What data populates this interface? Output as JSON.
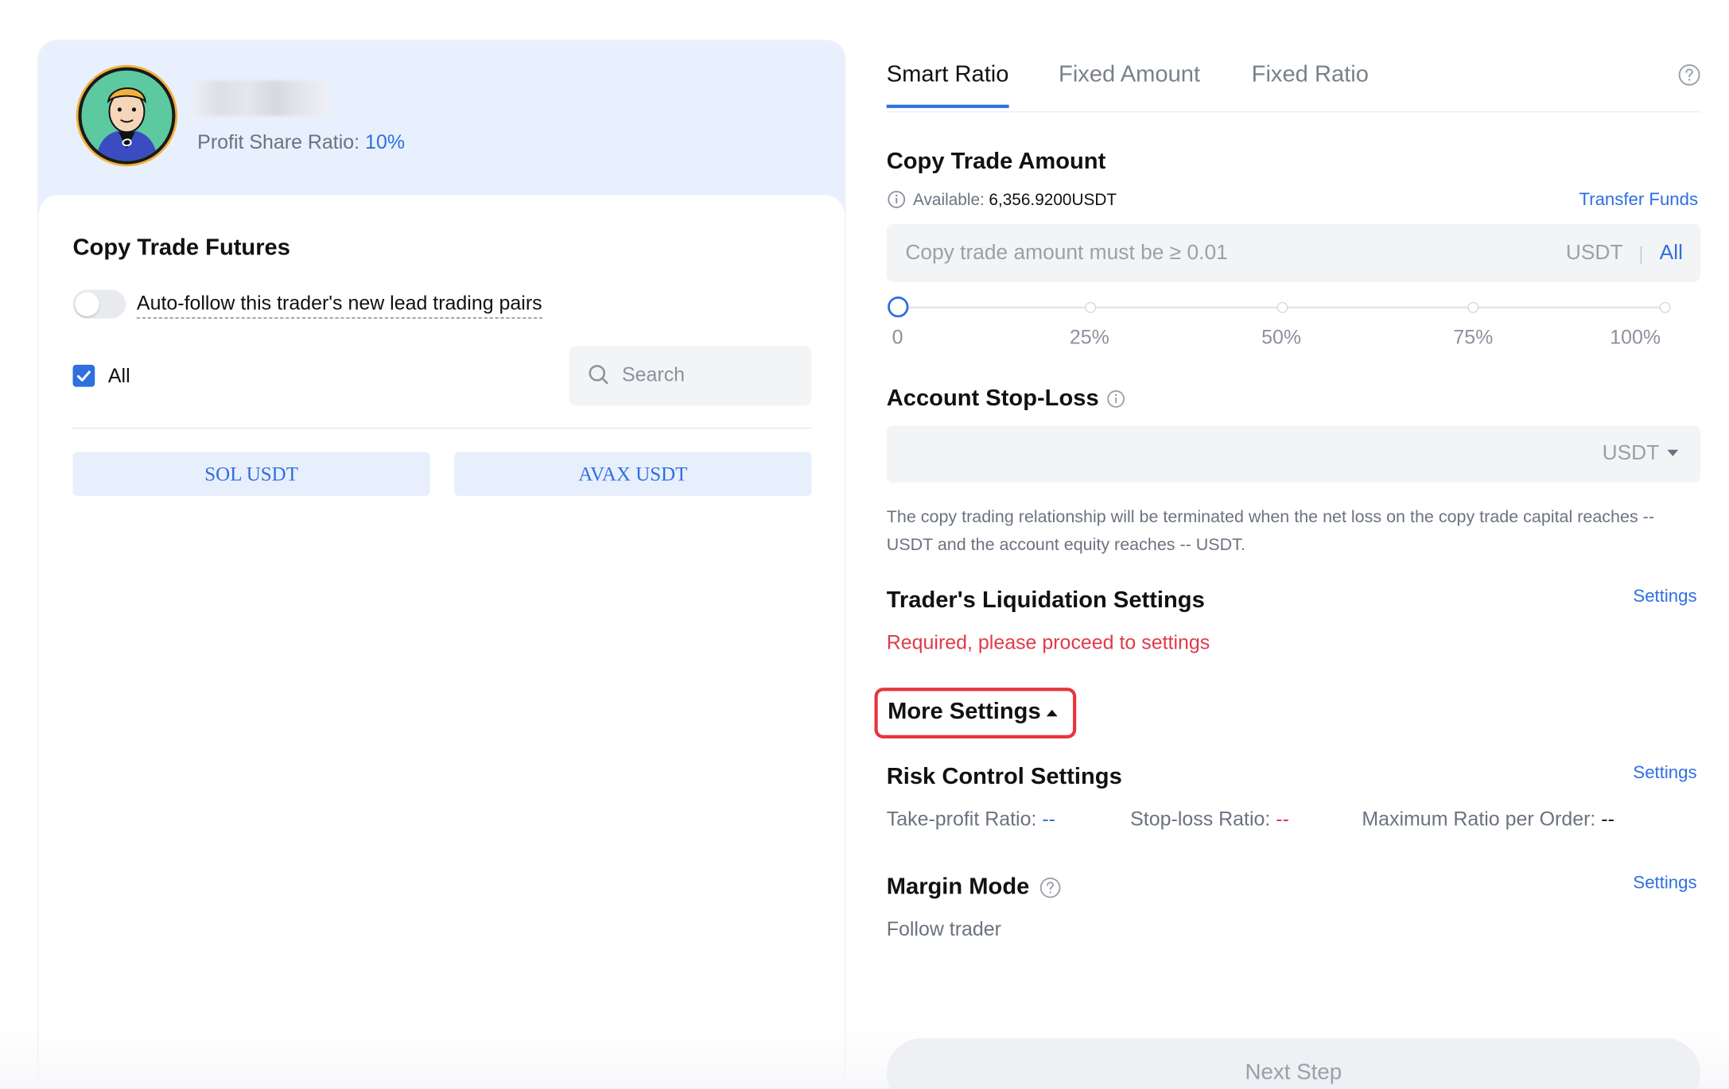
{
  "trader": {
    "profit_share_label": "Profit Share Ratio:",
    "profit_share_value": "10%"
  },
  "left": {
    "section_title": "Copy Trade Futures",
    "auto_follow_label": "Auto-follow this trader's new lead trading pairs",
    "auto_follow_enabled": false,
    "all_label": "All",
    "all_checked": true,
    "search_placeholder": "Search",
    "pairs": [
      "SOL USDT",
      "AVAX USDT"
    ]
  },
  "tabs": [
    {
      "label": "Smart Ratio",
      "active": true
    },
    {
      "label": "Fixed Amount",
      "active": false
    },
    {
      "label": "Fixed Ratio",
      "active": false
    }
  ],
  "copy_amount": {
    "title": "Copy Trade Amount",
    "available_label": "Available:",
    "available_value": "6,356.9200USDT",
    "transfer_link": "Transfer Funds",
    "placeholder": "Copy trade amount must be ≥ 0.01",
    "unit": "USDT",
    "all_label": "All",
    "slider_value": 0,
    "slider_marks": [
      "0",
      "25%",
      "50%",
      "75%",
      "100%"
    ]
  },
  "stop_loss": {
    "title": "Account Stop-Loss",
    "unit": "USDT",
    "note": "The copy trading relationship will be terminated when the net loss on the copy trade capital reaches -- USDT and the account equity reaches -- USDT."
  },
  "liquidation": {
    "title": "Trader's Liquidation Settings",
    "settings_link": "Settings",
    "required_text": "Required, please proceed to settings"
  },
  "more_settings": {
    "label": "More Settings"
  },
  "risk_control": {
    "title": "Risk Control Settings",
    "settings_link": "Settings",
    "take_profit_label": "Take-profit Ratio:",
    "take_profit_value": "--",
    "stop_loss_label": "Stop-loss Ratio:",
    "stop_loss_value": "--",
    "max_ratio_label": "Maximum Ratio per Order:",
    "max_ratio_value": "--"
  },
  "margin_mode": {
    "title": "Margin Mode",
    "settings_link": "Settings",
    "value": "Follow trader"
  },
  "next_button": "Next Step",
  "colors": {
    "accent": "#2f6fdf",
    "danger": "#e03a4a",
    "header_bg": "#e9f0fd"
  }
}
